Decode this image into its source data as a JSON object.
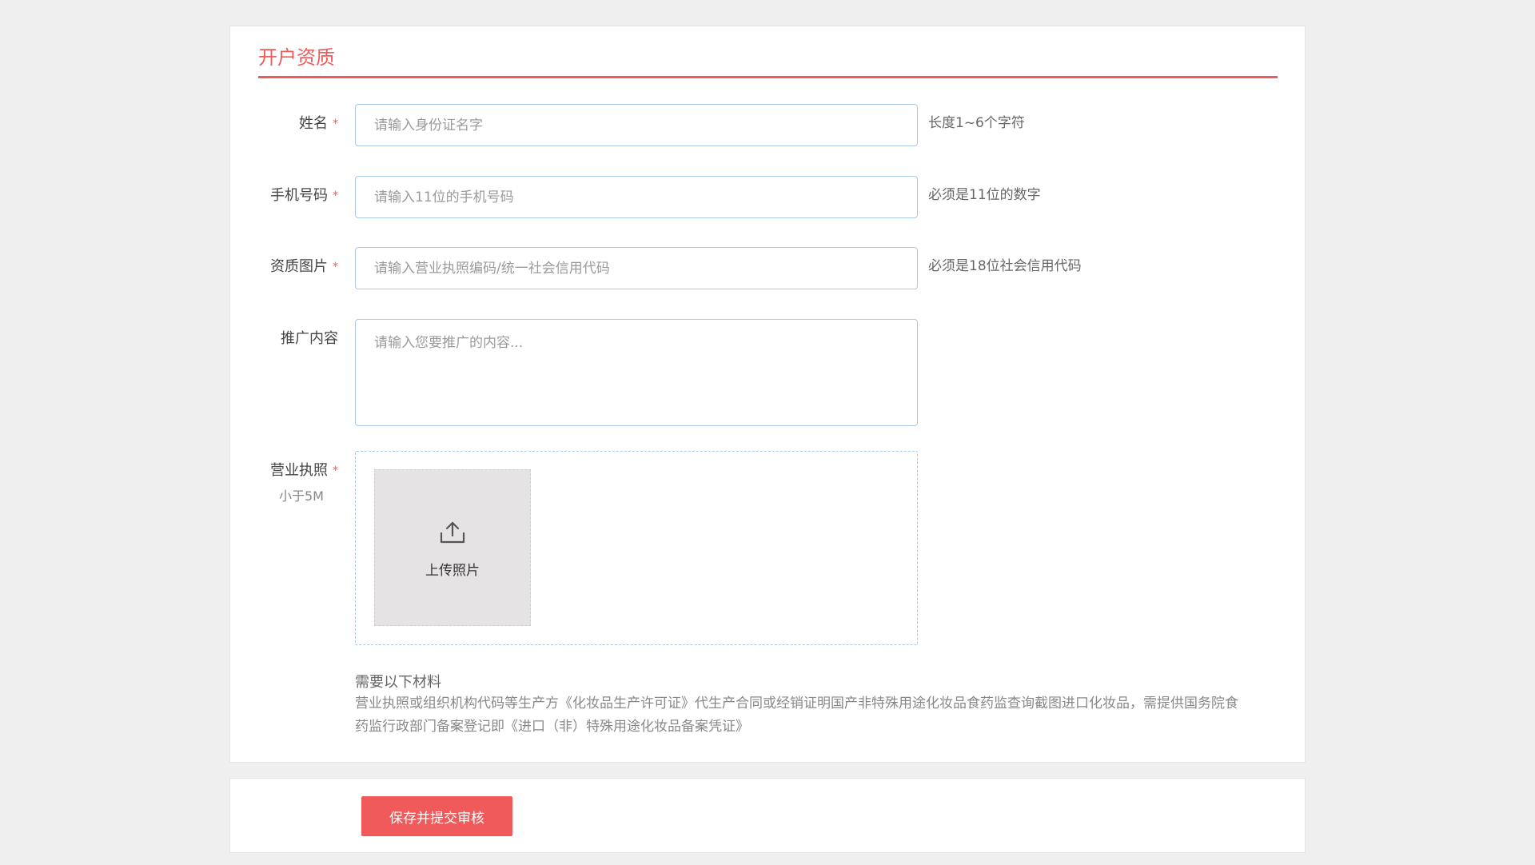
{
  "section": {
    "title": "开户资质"
  },
  "fields": {
    "name": {
      "label": "姓名",
      "required_mark": "*",
      "placeholder": "请输入身份证名字",
      "hint": "长度1~6个字符"
    },
    "phone": {
      "label": "手机号码",
      "required_mark": "*",
      "placeholder": "请输入11位的手机号码",
      "hint": "必须是11位的数字"
    },
    "qualification": {
      "label": "资质图片",
      "required_mark": "*",
      "placeholder": "请输入营业执照编码/统一社会信用代码",
      "hint": "必须是18位社会信用代码"
    },
    "promotion": {
      "label": "推广内容",
      "placeholder": "请输入您要推广的内容..."
    },
    "license": {
      "label": "营业执照",
      "required_mark": "*",
      "sublabel": "小于5M",
      "upload_label": "上传照片"
    }
  },
  "materials": {
    "title": "需要以下材料",
    "text": "营业执照或组织机构代码等生产方《化妆品生产许可证》代生产合同或经销证明国产非特殊用途化妆品食药监查询截图进口化妆品，需提供国务院食药监行政部门备案登记即《进口（非）特殊用途化妆品备案凭证》"
  },
  "footer": {
    "submit_label": "保存并提交审核"
  },
  "colors": {
    "accent": "#f15a5a",
    "input_border": "#a9c8ea"
  }
}
